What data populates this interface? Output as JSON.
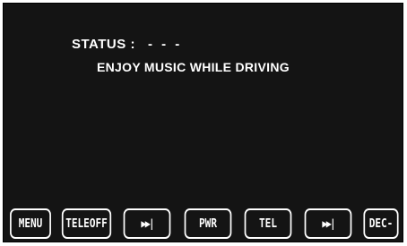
{
  "display": {
    "status_label": "STATUS :",
    "status_value": "- - -",
    "message": "ENJOY MUSIC WHILE DRIVING"
  },
  "softkeys": [
    {
      "label": "MENU",
      "kind": "text"
    },
    {
      "label": "TELEOFF",
      "kind": "text"
    },
    {
      "label": "▶▶|",
      "kind": "icon",
      "icon": "skip-forward-icon"
    },
    {
      "label": "PWR",
      "kind": "text"
    },
    {
      "label": "TEL",
      "kind": "text"
    },
    {
      "label": "▶▶|",
      "kind": "icon",
      "icon": "skip-forward-icon"
    },
    {
      "label": "DEC-",
      "kind": "text"
    }
  ],
  "colors": {
    "screen_background": "#141414",
    "text": "#ffffff",
    "page_background": "#ffffff"
  }
}
